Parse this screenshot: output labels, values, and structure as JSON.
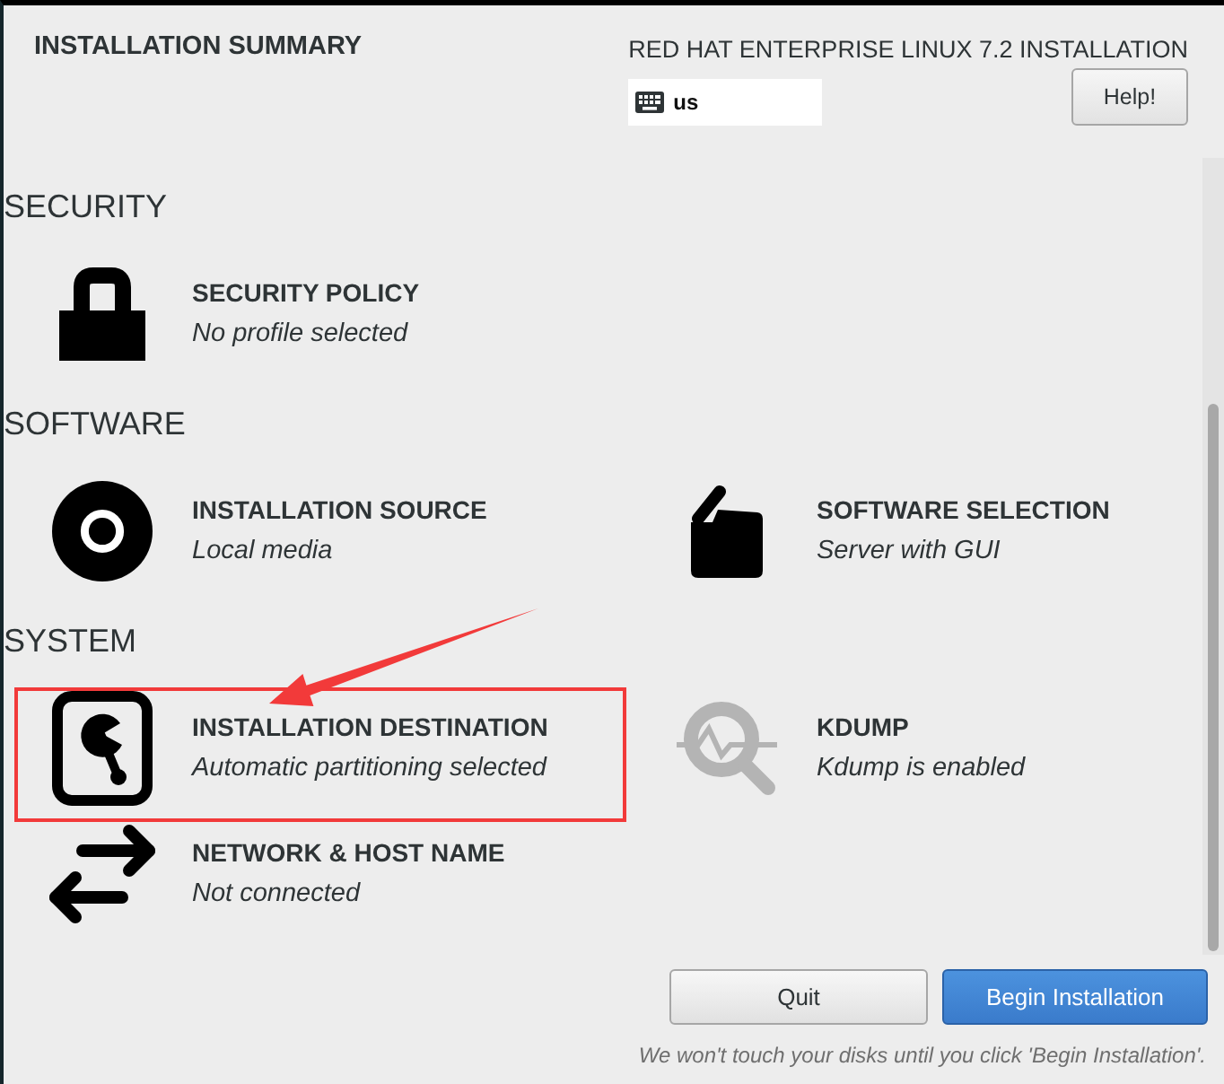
{
  "header": {
    "title": "INSTALLATION SUMMARY",
    "product": "RED HAT ENTERPRISE LINUX 7.2 INSTALLATION",
    "keyboard_layout": "us",
    "help_button": "Help!"
  },
  "sections": [
    {
      "heading": "SECURITY",
      "items": [
        {
          "kind": "lock",
          "title": "SECURITY POLICY",
          "status": "No profile selected",
          "highlighted": false
        }
      ]
    },
    {
      "heading": "SOFTWARE",
      "items": [
        {
          "kind": "disc",
          "title": "INSTALLATION SOURCE",
          "status": "Local media",
          "highlighted": false
        },
        {
          "kind": "package",
          "title": "SOFTWARE SELECTION",
          "status": "Server with GUI",
          "highlighted": false
        }
      ]
    },
    {
      "heading": "SYSTEM",
      "items": [
        {
          "kind": "disk",
          "title": "INSTALLATION DESTINATION",
          "status": "Automatic partitioning selected",
          "highlighted": true
        },
        {
          "kind": "kdump",
          "title": "KDUMP",
          "status": "Kdump is enabled",
          "highlighted": false
        },
        {
          "kind": "network",
          "title": "NETWORK & HOST NAME",
          "status": "Not connected",
          "highlighted": false
        }
      ]
    }
  ],
  "footer": {
    "buttons": [
      {
        "kind": "quit",
        "label": "Quit"
      },
      {
        "kind": "begin",
        "label": "Begin Installation"
      }
    ],
    "note": "We won't touch your disks until you click 'Begin Installation'."
  }
}
